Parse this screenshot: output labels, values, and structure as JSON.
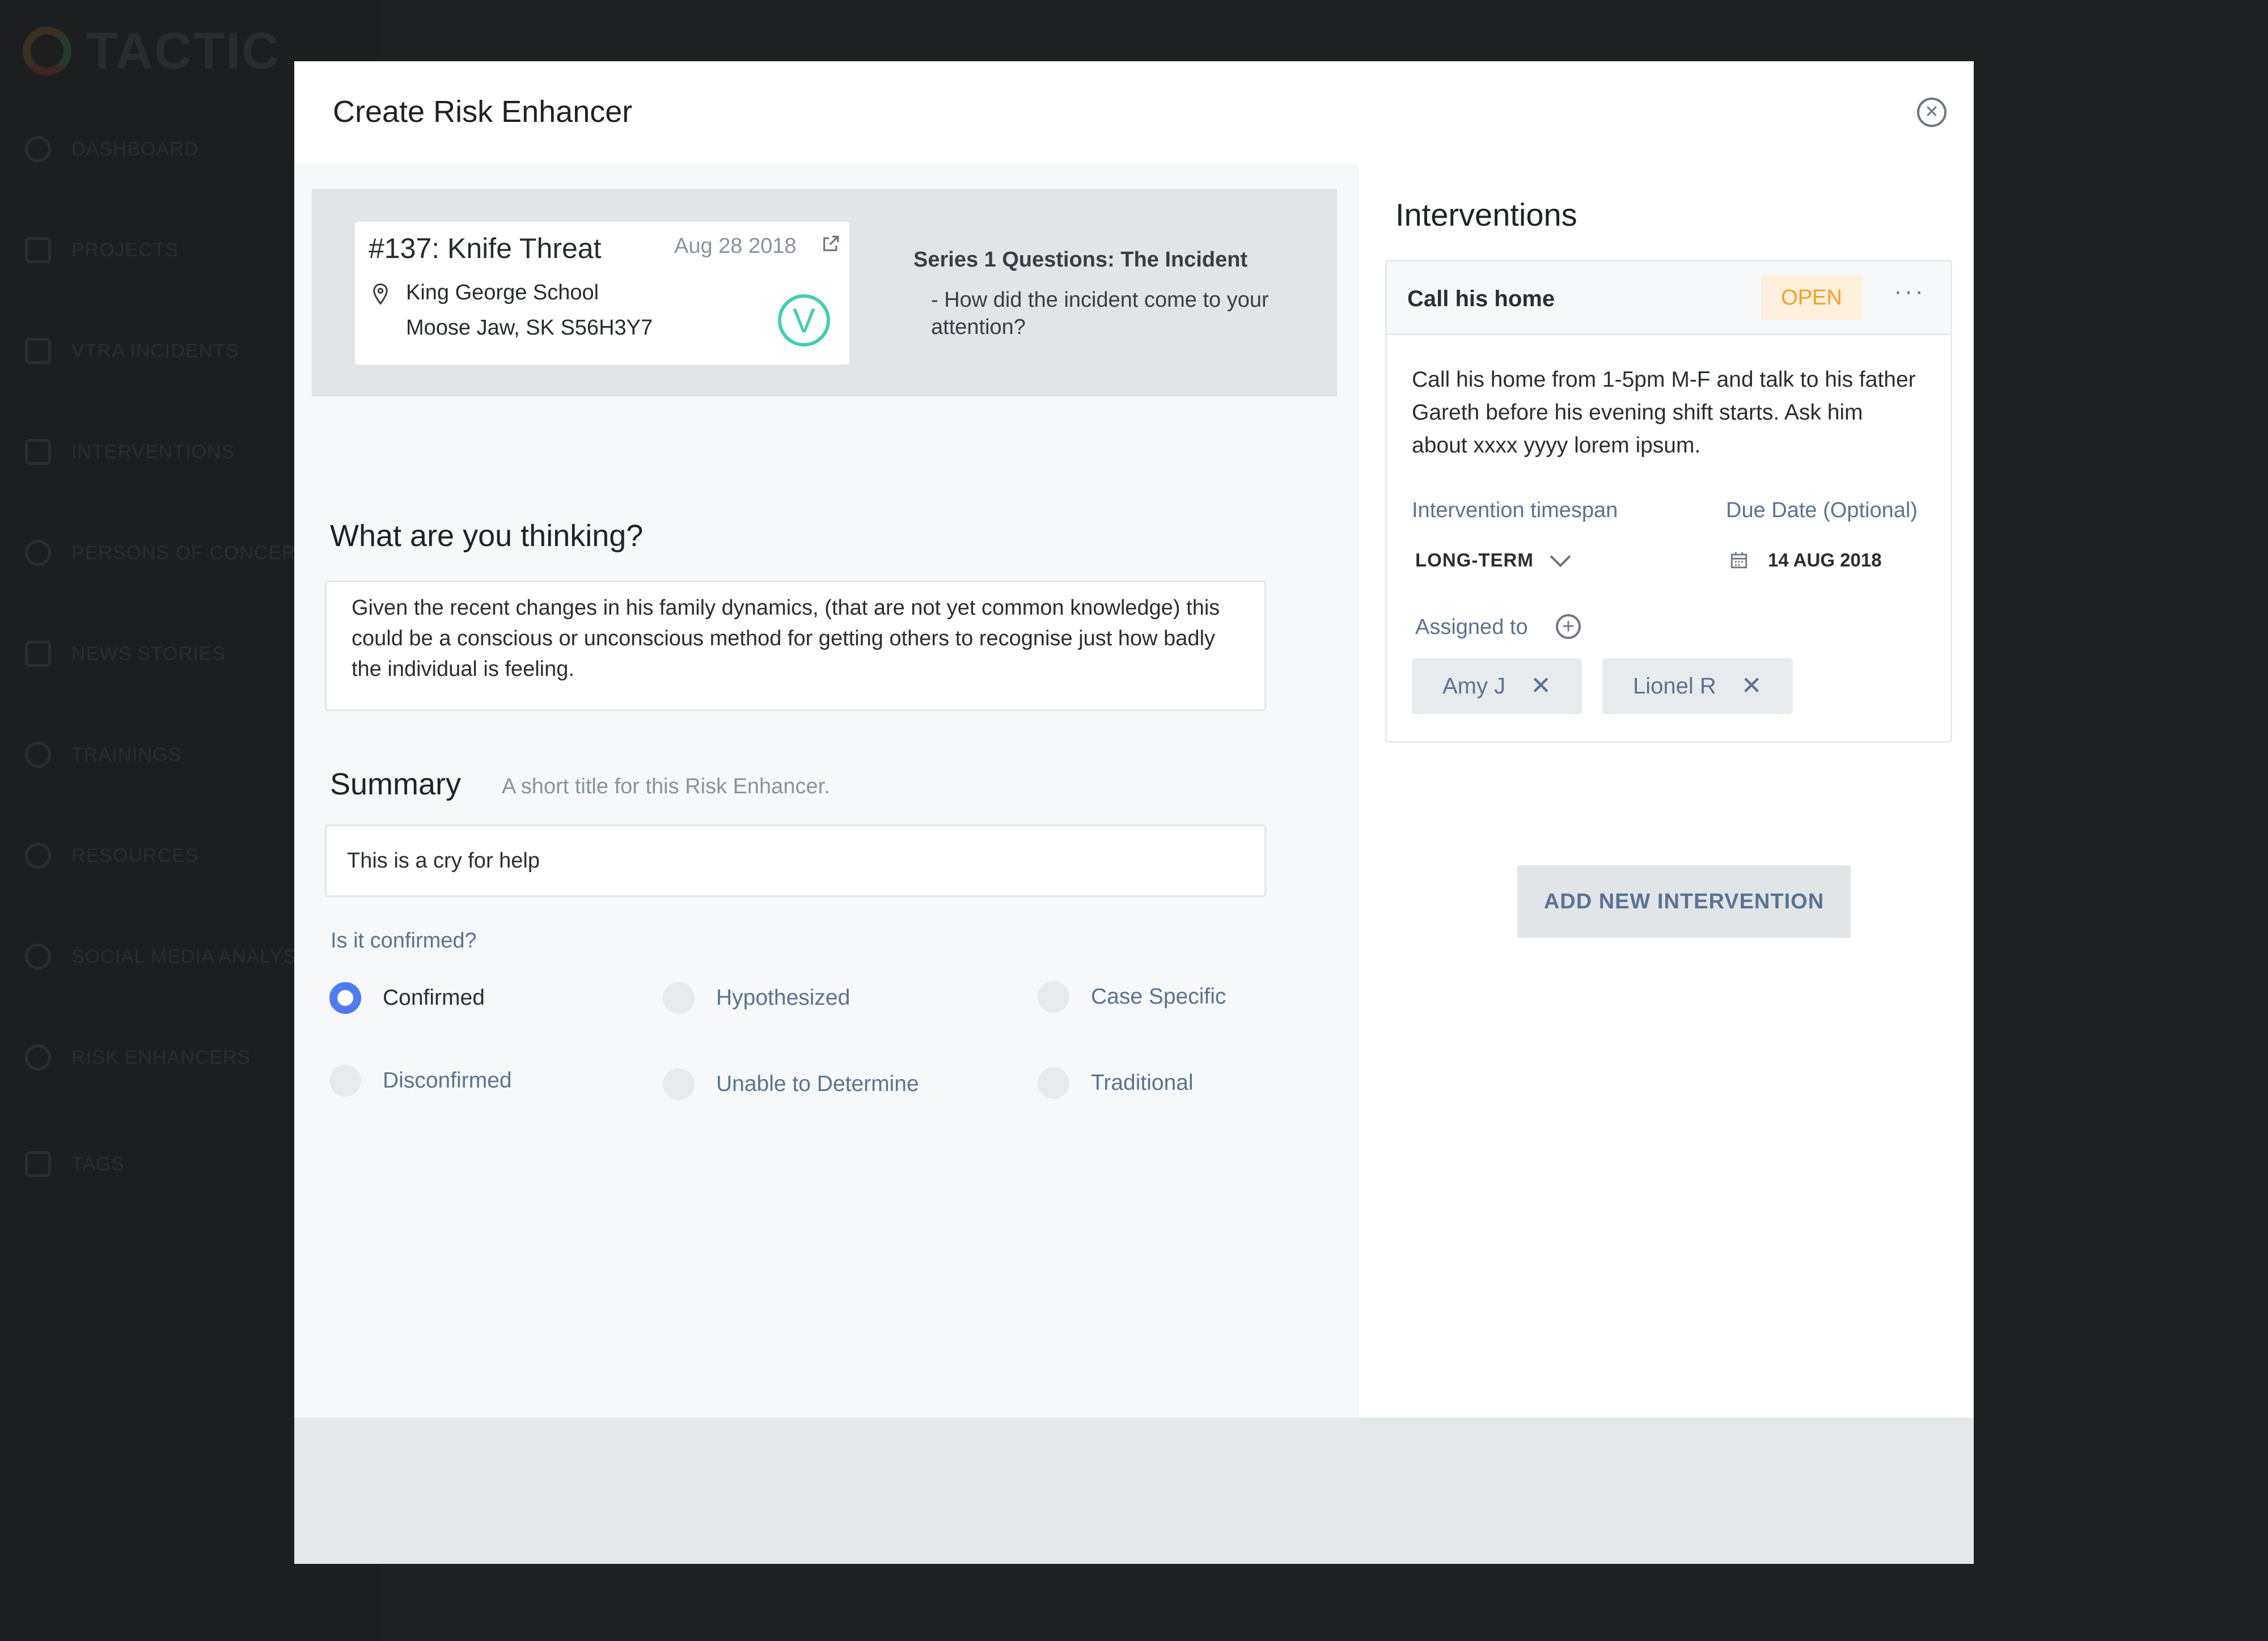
{
  "app": {
    "logo_text": "TACTIC",
    "nav": [
      {
        "label": "DASHBOARD",
        "icon": "clock-icon"
      },
      {
        "label": "PROJECTS",
        "icon": "folder-icon"
      },
      {
        "label": "VTRA INCIDENTS",
        "icon": "list-icon"
      },
      {
        "label": "INTERVENTIONS",
        "icon": "question-icon"
      },
      {
        "label": "PERSONS OF CONCERN",
        "icon": "person-pin-icon"
      },
      {
        "label": "NEWS STORIES",
        "icon": "newspaper-icon"
      },
      {
        "label": "TRAININGS",
        "icon": "training-icon"
      },
      {
        "label": "RESOURCES",
        "icon": "gear-icon"
      },
      {
        "label": "SOCIAL MEDIA ANALYSIS",
        "icon": "bug-icon"
      },
      {
        "label": "RISK ENHANCERS",
        "icon": "asterisk-icon"
      },
      {
        "label": "TAGS",
        "icon": "tag-icon"
      }
    ]
  },
  "modal": {
    "title": "Create Risk Enhancer",
    "incident": {
      "title": "#137: Knife Threat",
      "date": "Aug 28 2018",
      "address_line1": "King George School",
      "address_line2": "Moose Jaw, SK S56H3Y7",
      "badge": "V",
      "series_title": "Series 1 Questions: The Incident",
      "series_question": "- How did the incident come to your attention?"
    },
    "thinking": {
      "heading": "What are you thinking?",
      "value": "Given the recent changes in his family dynamics, (that are not yet common knowledge) this could be a conscious or unconscious method for getting others to recognise just how badly the individual is feeling."
    },
    "summary": {
      "heading": "Summary",
      "hint": "A short title for this Risk Enhancer.",
      "value": "This is a cry for help"
    },
    "confirmation": {
      "label": "Is it confirmed?",
      "options": [
        "Confirmed",
        "Hypothesized",
        "Case Specific",
        "Disconfirmed",
        "Unable to Determine",
        "Traditional"
      ],
      "selected": "Confirmed"
    },
    "interventions": {
      "heading": "Interventions",
      "items": [
        {
          "name": "Call his home",
          "status": "OPEN",
          "more": "···",
          "description": "Call his home from 1-5pm M-F and talk to his father Gareth before his evening shift starts. Ask him about xxxx yyyy lorem ipsum.",
          "timespan_label": "Intervention timespan",
          "timespan_value": "LONG-TERM",
          "due_label": "Due Date (Optional)",
          "due_value": "14 AUG 2018",
          "assigned_label": "Assigned to",
          "assignees": [
            "Amy J",
            "Lionel R"
          ]
        }
      ],
      "add_button": "ADD NEW INTERVENTION"
    }
  },
  "colors": {
    "accent": "#4d7cf0",
    "status_open": "#f3a127",
    "badge_teal": "#3ecfb0",
    "muted_text": "#5b7390"
  }
}
